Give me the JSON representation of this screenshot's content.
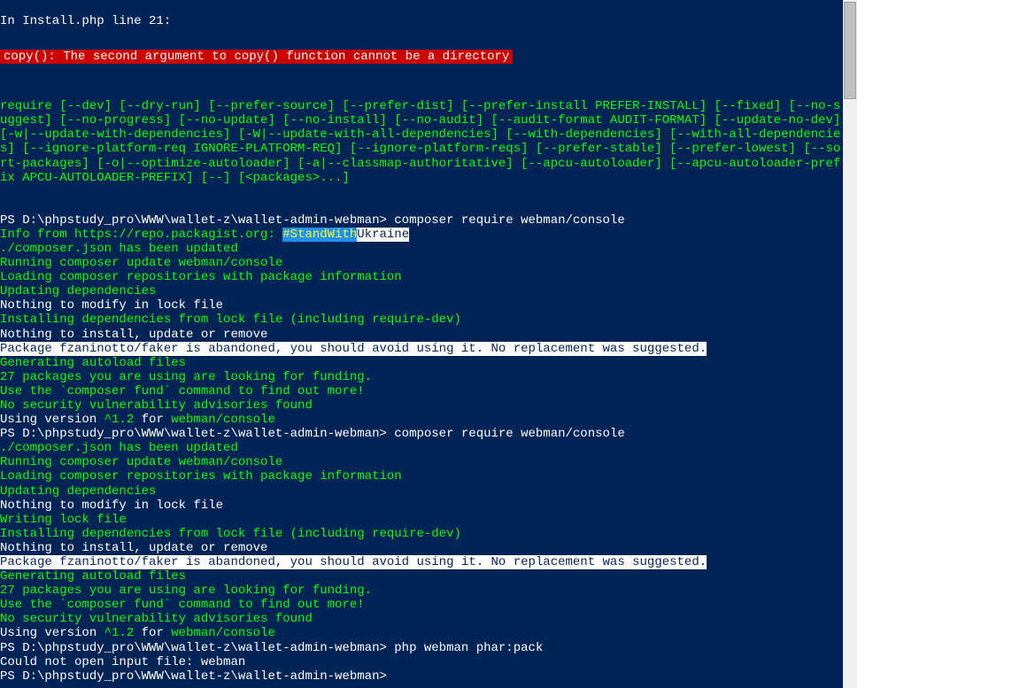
{
  "error": {
    "header": "In Install.php line 21:",
    "message": "  copy(): The second argument to copy() function cannot be a directory  "
  },
  "usage": "require [--dev] [--dry-run] [--prefer-source] [--prefer-dist] [--prefer-install PREFER-INSTALL] [--fixed] [--no-suggest] [--no-progress] [--no-update] [--no-install] [--no-audit] [--audit-format AUDIT-FORMAT] [--update-no-dev] [-w|--update-with-dependencies] [-W|--update-with-all-dependencies] [--with-dependencies] [--with-all-dependencies] [--ignore-platform-req IGNORE-PLATFORM-REQ] [--ignore-platform-reqs] [--prefer-stable] [--prefer-lowest] [--sort-packages] [-o|--optimize-autoloader] [-a|--classmap-authoritative] [--apcu-autoloader] [--apcu-autoloader-prefix APCU-AUTOLOADER-PREFIX] [--] [<packages>...]",
  "run1": {
    "prompt": "PS D:\\phpstudy_pro\\WWW\\wallet-z\\wallet-admin-webman> composer require webman/console",
    "info_prefix": "Info from https://repo.packagist.org: ",
    "standwith": "#StandWith",
    "ukraine": "Ukraine",
    "json_updated": "./composer.json has been updated",
    "running": "Running composer update webman/console",
    "loading": "Loading composer repositories with package information",
    "updating": "Updating dependencies",
    "nothing_modify": "Nothing to modify in lock file",
    "installing": "Installing dependencies from lock file (including require-dev)",
    "nothing_install": "Nothing to install, update or remove",
    "abandoned": "Package fzaninotto/faker is abandoned, you should avoid using it. No replacement was suggested.",
    "generating": "Generating autoload files",
    "funding": "27 packages you are using are looking for funding.",
    "fund_cmd": "Use the `composer fund` command to find out more!",
    "security": "No security vulnerability advisories found",
    "version_pre": "Using version ",
    "version_num": "^1.2",
    "version_mid": " for ",
    "version_pkg": "webman/console"
  },
  "run2": {
    "prompt": "PS D:\\phpstudy_pro\\WWW\\wallet-z\\wallet-admin-webman> composer require webman/console",
    "json_updated": "./composer.json has been updated",
    "running": "Running composer update webman/console",
    "loading": "Loading composer repositories with package information",
    "updating": "Updating dependencies",
    "nothing_modify": "Nothing to modify in lock file",
    "writing": "Writing lock file",
    "installing": "Installing dependencies from lock file (including require-dev)",
    "nothing_install": "Nothing to install, update or remove",
    "abandoned": "Package fzaninotto/faker is abandoned, you should avoid using it. No replacement was suggested.",
    "generating": "Generating autoload files",
    "funding": "27 packages you are using are looking for funding.",
    "fund_cmd": "Use the `composer fund` command to find out more!",
    "security": "No security vulnerability advisories found",
    "version_pre": "Using version ",
    "version_num": "^1.2",
    "version_mid": " for ",
    "version_pkg": "webman/console"
  },
  "run3": {
    "prompt": "PS D:\\phpstudy_pro\\WWW\\wallet-z\\wallet-admin-webman> php webman phar:pack",
    "error": "Could not open input file: webman",
    "prompt2": "PS D:\\phpstudy_pro\\WWW\\wallet-z\\wallet-admin-webman>"
  }
}
